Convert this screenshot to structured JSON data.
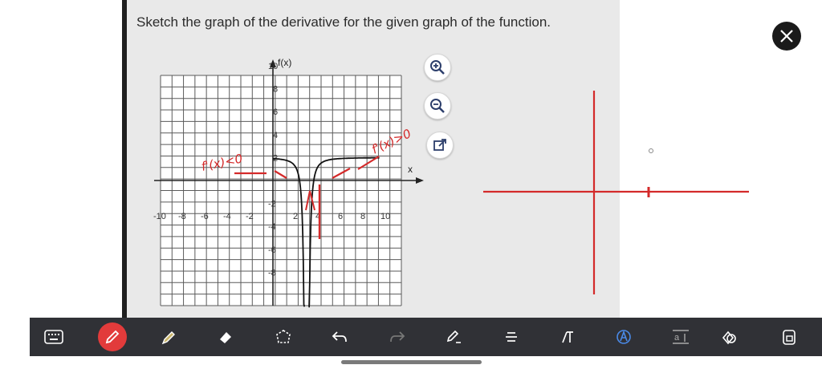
{
  "problem": {
    "prompt": "Sketch the graph of the derivative for the given graph of the function."
  },
  "graph": {
    "y_axis_label": "f(x)",
    "x_axis_label": "x",
    "x_ticks": [
      "-10",
      "-8",
      "-6",
      "-4",
      "-2",
      "2",
      "4",
      "6",
      "8",
      "10"
    ],
    "y_ticks": [
      "10",
      "8",
      "6",
      "4",
      "2",
      "-2",
      "-4",
      "-6",
      "-8"
    ]
  },
  "annotations": {
    "left": "f'(x)<0",
    "right": "f'(x)>0"
  },
  "graph_tools": {
    "zoom_in": "zoom-in-icon",
    "zoom_out": "zoom-out-icon",
    "popout": "external-link-icon"
  },
  "colors": {
    "ink": "#d42a2a",
    "toolbar_bg": "#303136",
    "screen_bg": "#e8e8e8",
    "close_bg": "#1a1a1a"
  },
  "toolbar": {
    "items": [
      "keyboard-icon",
      "pen-icon",
      "highlighter-icon",
      "eraser-icon",
      "lasso-icon",
      "undo-icon",
      "redo-icon",
      "shape-pen-icon",
      "text-align-icon",
      "text-icon",
      "text-style-icon",
      "text-size-icon",
      "shapes-icon",
      "lock-icon"
    ]
  }
}
